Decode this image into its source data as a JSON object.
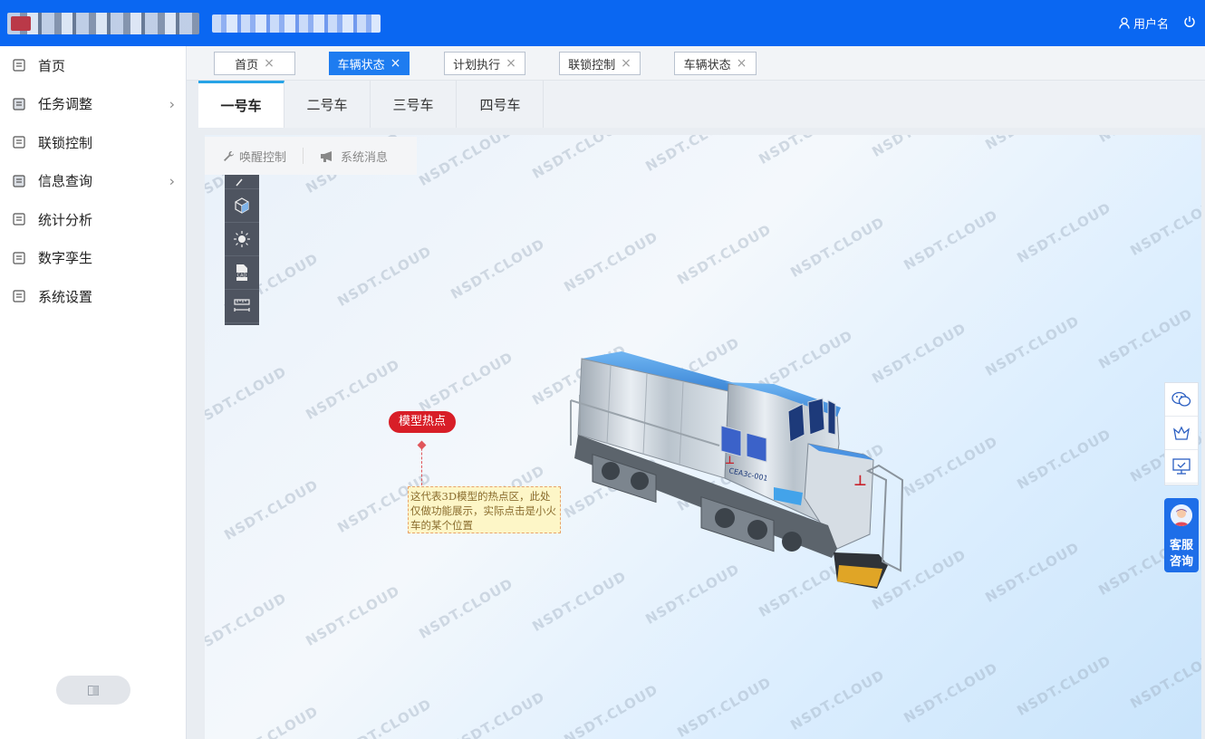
{
  "header": {
    "username": "用户名",
    "user_icon": "user-icon",
    "power_icon": "power-icon"
  },
  "sidebar": {
    "items": [
      {
        "label": "首页",
        "has_children": false
      },
      {
        "label": "任务调整",
        "has_children": true
      },
      {
        "label": "联锁控制",
        "has_children": false
      },
      {
        "label": "信息查询",
        "has_children": true
      },
      {
        "label": "统计分析",
        "has_children": false
      },
      {
        "label": "数字孪生",
        "has_children": false
      },
      {
        "label": "系统设置",
        "has_children": false
      }
    ]
  },
  "page_tabs": [
    {
      "label": "首页",
      "active": false
    },
    {
      "label": "车辆状态",
      "active": true
    },
    {
      "label": "计划执行",
      "active": false
    },
    {
      "label": "联锁控制",
      "active": false
    },
    {
      "label": "车辆状态",
      "active": false
    }
  ],
  "vehicle_tabs": [
    {
      "label": "一号车",
      "active": true
    },
    {
      "label": "二号车",
      "active": false
    },
    {
      "label": "三号车",
      "active": false
    },
    {
      "label": "四号车",
      "active": false
    }
  ],
  "viewer": {
    "toolbar": {
      "wake_control": "唤醒控制",
      "system_message": "系统消息"
    },
    "watermark": "NSDT.CLOUD",
    "hotspot": {
      "label": "模型热点",
      "note": "这代表3D模型的热点区，此处仅做功能展示，实际点击是小火车的某个位置"
    },
    "train_plate": "CEA3c-001"
  },
  "customer_service": {
    "label": "客服咨询"
  },
  "colors": {
    "header": "#0a67f2",
    "active_tab": "#1e7cf0",
    "hotspot": "#d81e27",
    "active_vtab_border": "#27a3e6"
  }
}
